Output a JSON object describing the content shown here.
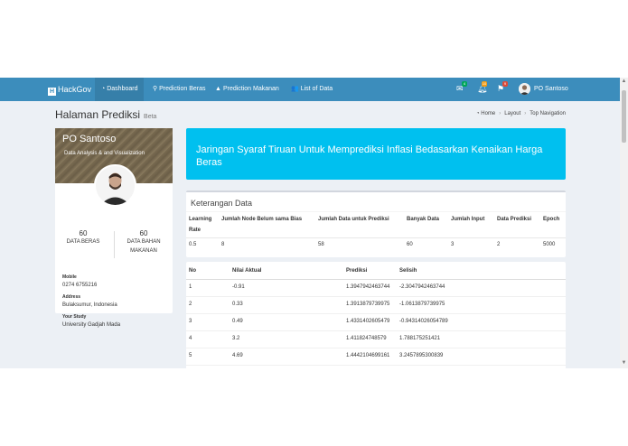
{
  "navbar": {
    "brand": "HackGov",
    "items": [
      {
        "label": "Dashboard",
        "icon": "dashboard-icon",
        "active": true
      },
      {
        "label": "Prediction Beras",
        "icon": "map-marker-icon",
        "active": false
      },
      {
        "label": "Prediction Makanan",
        "icon": "area-chart-icon",
        "active": false
      },
      {
        "label": "List of Data",
        "icon": "users-icon",
        "active": false
      }
    ],
    "badges": {
      "messages": "4",
      "notifications": "10",
      "tasks": "9"
    },
    "user_name": "PO Santoso",
    "colors": {
      "bar": "#3c8dbc",
      "active": "#367fa9",
      "badge_green": "#00a65a",
      "badge_yellow": "#f39c12",
      "badge_red": "#dd4b39"
    }
  },
  "header": {
    "title": "Halaman Prediksi",
    "subtitle": "Beta",
    "breadcrumb": [
      "Home",
      "Layout",
      "Top Navigation"
    ]
  },
  "profile": {
    "name": "PO Santoso",
    "role": "Data Analysis & and Visualization",
    "stats": [
      {
        "value": "60",
        "label": "DATA BERAS"
      },
      {
        "value": "60",
        "label": "DATA BAHAN MAKANAN"
      }
    ],
    "info": [
      {
        "label": "Mobile",
        "value": "0274 6755216"
      },
      {
        "label": "Address",
        "value": "Bulaksumur, Indonesia"
      },
      {
        "label": "Your Study",
        "value": "University Gadjah Mada"
      }
    ]
  },
  "callout": {
    "text": "Jaringan Syaraf Tiruan Untuk Memprediksi Inflasi Bedasarkan Kenaikan Harga Beras",
    "color": "#00c0ef"
  },
  "keterangan": {
    "title": "Keterangan Data",
    "headers": [
      "Learning Rate",
      "Jumlah Node Belum sama Bias",
      "Jumlah Data untuk Prediksi",
      "Banyak Data",
      "Jumlah Input",
      "Data Prediksi",
      "Epoch"
    ],
    "values": [
      "0.5",
      "8",
      "58",
      "60",
      "3",
      "2",
      "5000"
    ]
  },
  "results": {
    "headers": [
      "No",
      "Nilai Aktual",
      "Prediksi",
      "Selisih"
    ],
    "rows": [
      [
        "1",
        "-0.91",
        "1.3947942463744",
        "-2.3047942463744"
      ],
      [
        "2",
        "0.33",
        "1.3913879739975",
        "-1.0613879739975"
      ],
      [
        "3",
        "0.49",
        "1.4331402605479",
        "-0.94314026054789"
      ],
      [
        "4",
        "3.2",
        "1.411824748579",
        "1.788175251421"
      ],
      [
        "5",
        "4.69",
        "1.4442104699161",
        "3.2457895300839"
      ]
    ]
  }
}
